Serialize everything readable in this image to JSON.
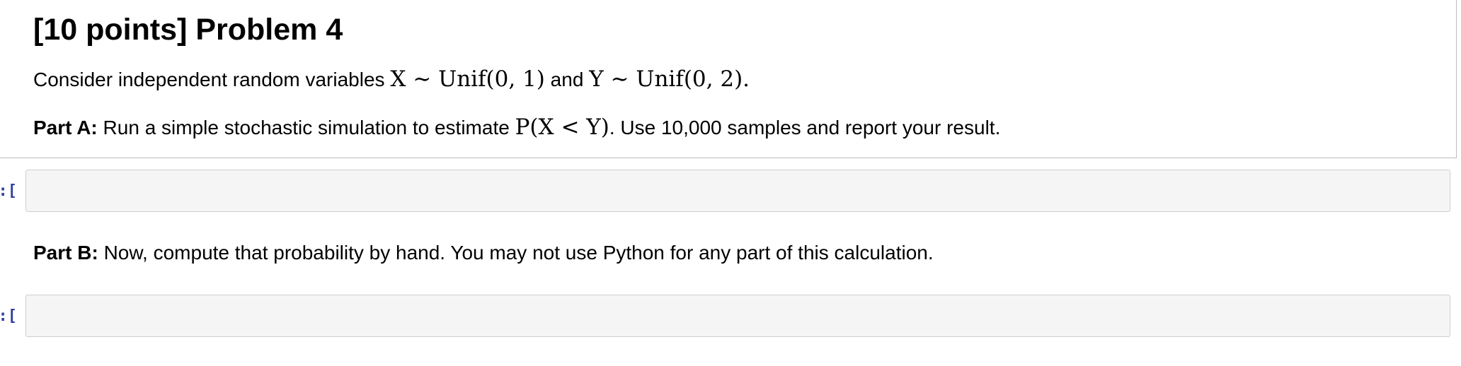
{
  "problem": {
    "heading": "[10 points] Problem 4",
    "intro_text": "Consider independent random variables ",
    "intro_x_math": "X ∼ Unif(0, 1)",
    "intro_and": " and ",
    "intro_y_math": "Y ∼ Unif(0, 2)",
    "intro_end": "."
  },
  "part_a": {
    "label": "Part A:",
    "text_before": " Run a simple stochastic simulation to estimate ",
    "math": "P(X < Y)",
    "text_after": ". Use 10,000 samples and report your result."
  },
  "part_b": {
    "label": "Part B:",
    "text": " Now, compute that probability by hand. You may not use Python for any part of this calculation."
  },
  "cells": [
    {
      "prompt": "]:",
      "content": ""
    },
    {
      "prompt": "]:",
      "content": ""
    }
  ]
}
